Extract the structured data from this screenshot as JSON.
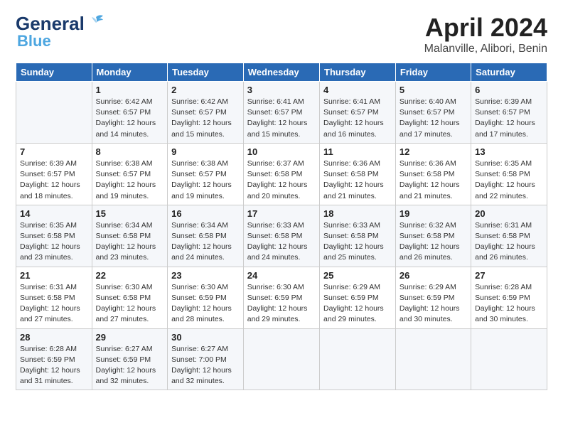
{
  "header": {
    "logo_line1": "General",
    "logo_line2": "Blue",
    "title": "April 2024",
    "subtitle": "Malanville, Alibori, Benin"
  },
  "weekdays": [
    "Sunday",
    "Monday",
    "Tuesday",
    "Wednesday",
    "Thursday",
    "Friday",
    "Saturday"
  ],
  "weeks": [
    [
      {
        "day": "",
        "info": ""
      },
      {
        "day": "1",
        "info": "Sunrise: 6:42 AM\nSunset: 6:57 PM\nDaylight: 12 hours\nand 14 minutes."
      },
      {
        "day": "2",
        "info": "Sunrise: 6:42 AM\nSunset: 6:57 PM\nDaylight: 12 hours\nand 15 minutes."
      },
      {
        "day": "3",
        "info": "Sunrise: 6:41 AM\nSunset: 6:57 PM\nDaylight: 12 hours\nand 15 minutes."
      },
      {
        "day": "4",
        "info": "Sunrise: 6:41 AM\nSunset: 6:57 PM\nDaylight: 12 hours\nand 16 minutes."
      },
      {
        "day": "5",
        "info": "Sunrise: 6:40 AM\nSunset: 6:57 PM\nDaylight: 12 hours\nand 17 minutes."
      },
      {
        "day": "6",
        "info": "Sunrise: 6:39 AM\nSunset: 6:57 PM\nDaylight: 12 hours\nand 17 minutes."
      }
    ],
    [
      {
        "day": "7",
        "info": "Sunrise: 6:39 AM\nSunset: 6:57 PM\nDaylight: 12 hours\nand 18 minutes."
      },
      {
        "day": "8",
        "info": "Sunrise: 6:38 AM\nSunset: 6:57 PM\nDaylight: 12 hours\nand 19 minutes."
      },
      {
        "day": "9",
        "info": "Sunrise: 6:38 AM\nSunset: 6:57 PM\nDaylight: 12 hours\nand 19 minutes."
      },
      {
        "day": "10",
        "info": "Sunrise: 6:37 AM\nSunset: 6:58 PM\nDaylight: 12 hours\nand 20 minutes."
      },
      {
        "day": "11",
        "info": "Sunrise: 6:36 AM\nSunset: 6:58 PM\nDaylight: 12 hours\nand 21 minutes."
      },
      {
        "day": "12",
        "info": "Sunrise: 6:36 AM\nSunset: 6:58 PM\nDaylight: 12 hours\nand 21 minutes."
      },
      {
        "day": "13",
        "info": "Sunrise: 6:35 AM\nSunset: 6:58 PM\nDaylight: 12 hours\nand 22 minutes."
      }
    ],
    [
      {
        "day": "14",
        "info": "Sunrise: 6:35 AM\nSunset: 6:58 PM\nDaylight: 12 hours\nand 23 minutes."
      },
      {
        "day": "15",
        "info": "Sunrise: 6:34 AM\nSunset: 6:58 PM\nDaylight: 12 hours\nand 23 minutes."
      },
      {
        "day": "16",
        "info": "Sunrise: 6:34 AM\nSunset: 6:58 PM\nDaylight: 12 hours\nand 24 minutes."
      },
      {
        "day": "17",
        "info": "Sunrise: 6:33 AM\nSunset: 6:58 PM\nDaylight: 12 hours\nand 24 minutes."
      },
      {
        "day": "18",
        "info": "Sunrise: 6:33 AM\nSunset: 6:58 PM\nDaylight: 12 hours\nand 25 minutes."
      },
      {
        "day": "19",
        "info": "Sunrise: 6:32 AM\nSunset: 6:58 PM\nDaylight: 12 hours\nand 26 minutes."
      },
      {
        "day": "20",
        "info": "Sunrise: 6:31 AM\nSunset: 6:58 PM\nDaylight: 12 hours\nand 26 minutes."
      }
    ],
    [
      {
        "day": "21",
        "info": "Sunrise: 6:31 AM\nSunset: 6:58 PM\nDaylight: 12 hours\nand 27 minutes."
      },
      {
        "day": "22",
        "info": "Sunrise: 6:30 AM\nSunset: 6:58 PM\nDaylight: 12 hours\nand 27 minutes."
      },
      {
        "day": "23",
        "info": "Sunrise: 6:30 AM\nSunset: 6:59 PM\nDaylight: 12 hours\nand 28 minutes."
      },
      {
        "day": "24",
        "info": "Sunrise: 6:30 AM\nSunset: 6:59 PM\nDaylight: 12 hours\nand 29 minutes."
      },
      {
        "day": "25",
        "info": "Sunrise: 6:29 AM\nSunset: 6:59 PM\nDaylight: 12 hours\nand 29 minutes."
      },
      {
        "day": "26",
        "info": "Sunrise: 6:29 AM\nSunset: 6:59 PM\nDaylight: 12 hours\nand 30 minutes."
      },
      {
        "day": "27",
        "info": "Sunrise: 6:28 AM\nSunset: 6:59 PM\nDaylight: 12 hours\nand 30 minutes."
      }
    ],
    [
      {
        "day": "28",
        "info": "Sunrise: 6:28 AM\nSunset: 6:59 PM\nDaylight: 12 hours\nand 31 minutes."
      },
      {
        "day": "29",
        "info": "Sunrise: 6:27 AM\nSunset: 6:59 PM\nDaylight: 12 hours\nand 32 minutes."
      },
      {
        "day": "30",
        "info": "Sunrise: 6:27 AM\nSunset: 7:00 PM\nDaylight: 12 hours\nand 32 minutes."
      },
      {
        "day": "",
        "info": ""
      },
      {
        "day": "",
        "info": ""
      },
      {
        "day": "",
        "info": ""
      },
      {
        "day": "",
        "info": ""
      }
    ]
  ]
}
